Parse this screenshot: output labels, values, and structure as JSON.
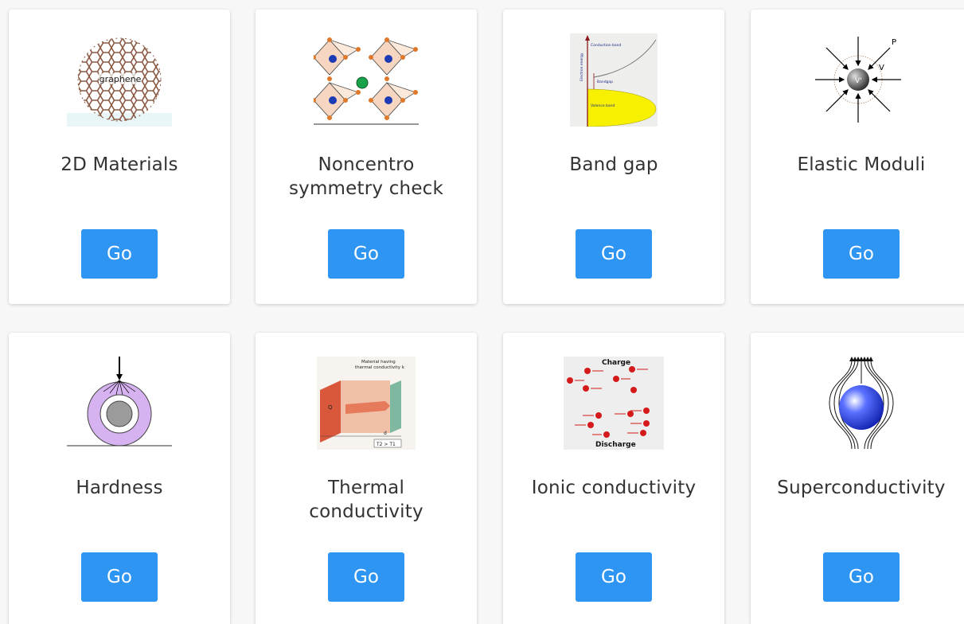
{
  "cards": [
    {
      "title": "2D Materials",
      "button": "Go",
      "image_label": "graphene"
    },
    {
      "title": "Noncentro\nsymmetry check",
      "button": "Go"
    },
    {
      "title": "Band gap",
      "button": "Go",
      "image_labels": {
        "conduction": "Conduction band",
        "energy": "Electron energy",
        "gap": "Bandgap",
        "valence": "Valence band"
      }
    },
    {
      "title": "Elastic Moduli",
      "button": "Go",
      "image_labels": {
        "p": "P",
        "v": "V",
        "vprime": "V'"
      }
    },
    {
      "title": "Hardness",
      "button": "Go"
    },
    {
      "title": "Thermal\nconductivity",
      "button": "Go",
      "image_labels": {
        "material": "Material having",
        "thermal": "thermal conductivity k",
        "q": "Q",
        "d": "d",
        "temps": "T2 > T1"
      }
    },
    {
      "title": "Ionic conductivity",
      "button": "Go",
      "image_labels": {
        "charge": "Charge",
        "discharge": "Discharge"
      }
    },
    {
      "title": "Superconductivity",
      "button": "Go"
    }
  ],
  "colors": {
    "button": "#2f95f3",
    "card": "#ffffff",
    "background": "#f7f7f8",
    "text": "#333333"
  }
}
